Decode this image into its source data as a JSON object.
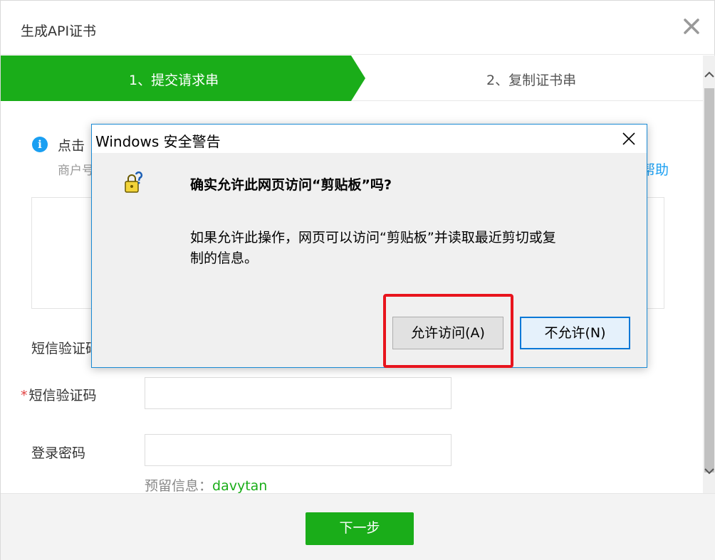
{
  "dialog": {
    "title": "生成API证书",
    "close_icon": "close-icon"
  },
  "steps": {
    "step1": "1、提交请求串",
    "step2": "2、复制证书串",
    "active_color": "#1aad19"
  },
  "info": {
    "icon": "info-icon",
    "text": "点击",
    "sub": "商户号",
    "help": "帮助"
  },
  "form": {
    "sms_label_hidden": "短信验证码",
    "sms_label": "短信验证码",
    "password_label": "登录密码",
    "hint_prefix": "预留信息：",
    "hint_value": "davytan"
  },
  "footer": {
    "next_label": "下一步"
  },
  "windows_alert": {
    "title": "Windows 安全警告",
    "question": "确实允许此网页访问“剪贴板”吗?",
    "body_line1": "如果允许此操作，网页可以访问“剪贴板”并读取最近剪切或复",
    "body_line2": "制的信息。",
    "allow_label": "允许访问(A)",
    "deny_label": "不允许(N)",
    "icon": "security-warning-icon"
  },
  "colors": {
    "brand_green": "#1aad19",
    "link_blue": "#1a9ff2",
    "highlight_red": "#e8141d",
    "windows_blue": "#0a78d7"
  }
}
